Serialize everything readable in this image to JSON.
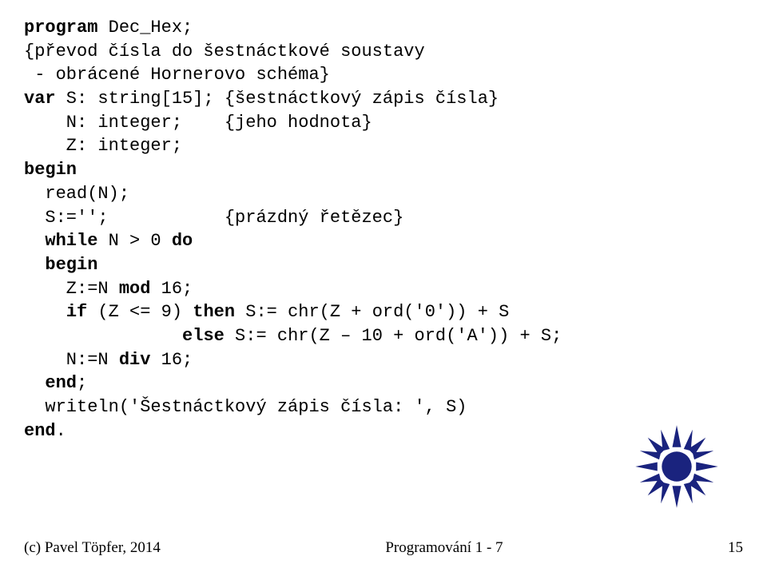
{
  "code": {
    "l1a": "program",
    "l1b": " Dec_Hex;",
    "l2": "{převod čísla do šestnáctkové soustavy",
    "l3": " - obrácené Hornerovo schéma}",
    "l4a": "var",
    "l4b": " S: string[15]; {šestnáctkový zápis čísla}",
    "l5": "    N: integer;    {jeho hodnota}",
    "l6": "    Z: integer;",
    "l7": "begin",
    "l8": "  read(N);",
    "l9": "  S:='';           {prázdný řetězec}",
    "l10a": "  ",
    "l10b": "while",
    "l10c": " N > 0 ",
    "l10d": "do",
    "l11a": "  ",
    "l11b": "begin",
    "l12a": "    Z:=N ",
    "l12b": "mod",
    "l12c": " 16;",
    "l13a": "    ",
    "l13b": "if",
    "l13c": " (Z <= 9) ",
    "l13d": "then",
    "l13e": " S:= chr(Z + ord('0')) + S",
    "l14a": "               ",
    "l14b": "else",
    "l14c": " S:= chr(Z – 10 + ord('A')) + S;",
    "l15a": "    N:=N ",
    "l15b": "div",
    "l15c": " 16;",
    "l16a": "  ",
    "l16b": "end",
    "l16c": ";",
    "l17": "  writeln('Šestnáctkový zápis čísla: ', S)",
    "l18a": "end",
    "l18b": "."
  },
  "footer": {
    "left": "(c) Pavel Töpfer, 2014",
    "center": "Programování 1 - 7",
    "right": "15"
  }
}
